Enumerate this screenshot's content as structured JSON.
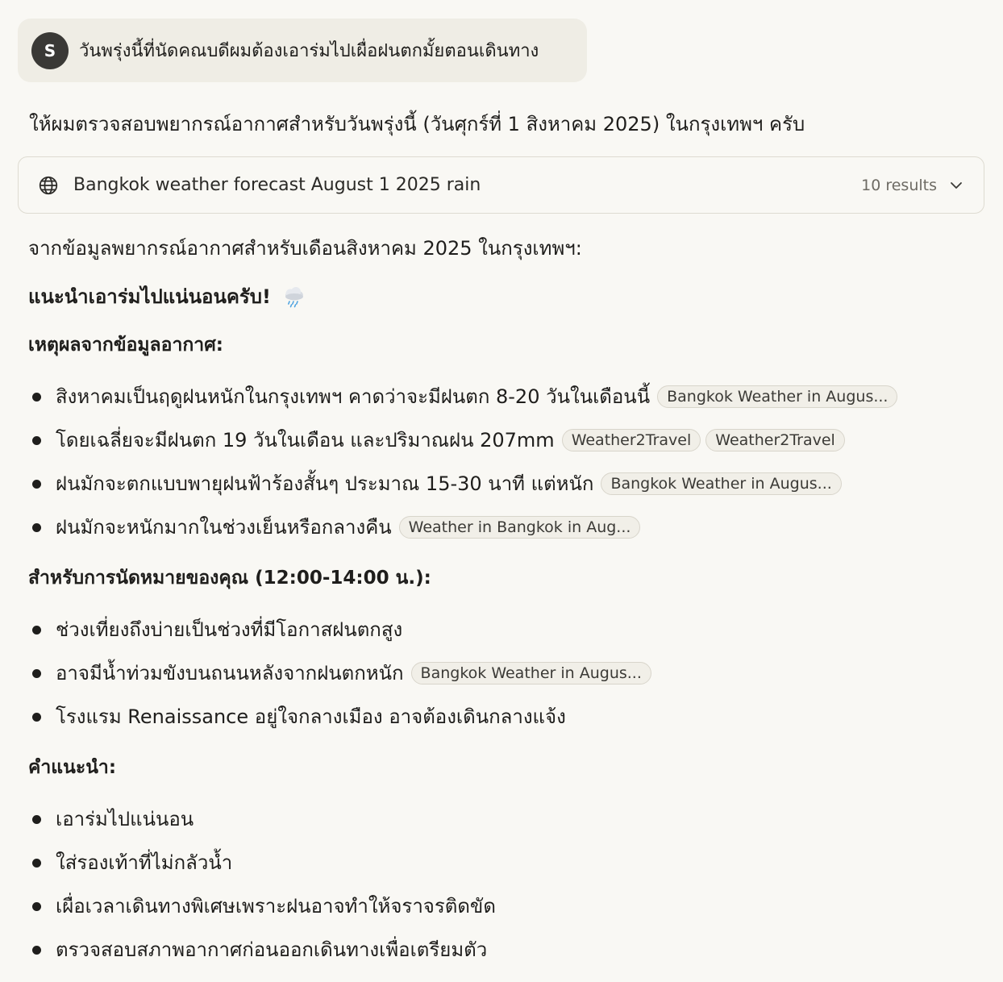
{
  "user_message": {
    "avatar_initial": "S",
    "text": "วันพรุ่งนี้ที่นัดคณบดีผมต้องเอาร่มไปเผื่อฝนตกมั้ยตอนเดินทาง"
  },
  "assistant": {
    "intro": "ให้ผมตรวจสอบพยากรณ์อากาศสำหรับวันพรุ่งนี้ (วันศุกร์ที่ 1 สิงหาคม 2025) ในกรุงเทพฯ ครับ",
    "search": {
      "query": "Bangkok weather forecast August 1 2025 rain",
      "results_count": "10 results"
    },
    "data_intro": "จากข้อมูลพยากรณ์อากาศสำหรับเดือนสิงหาคม 2025 ในกรุงเทพฯ:",
    "recommendation": "แนะนำเอาร่มไปแน่นอนครับ!",
    "reasons_heading": "เหตุผลจากข้อมูลอากาศ:",
    "reasons": [
      {
        "text": "สิงหาคมเป็นฤดูฝนหนักในกรุงเทพฯ คาดว่าจะมีฝนตก 8-20 วันในเดือนนี้",
        "chips": [
          "Bangkok Weather in Augus..."
        ]
      },
      {
        "text": "โดยเฉลี่ยจะมีฝนตก 19 วันในเดือน และปริมาณฝน 207mm",
        "chips": [
          "Weather2Travel",
          "Weather2Travel"
        ]
      },
      {
        "text": "ฝนมักจะตกแบบพายุฝนฟ้าร้องสั้นๆ ประมาณ 15-30 นาที แต่หนัก",
        "chips": [
          "Bangkok Weather in Augus..."
        ]
      },
      {
        "text": "ฝนมักจะหนักมากในช่วงเย็นหรือกลางคืน",
        "chips": [
          "Weather in Bangkok in Aug..."
        ]
      }
    ],
    "appointment_heading": "สำหรับการนัดหมายของคุณ (12:00-14:00 น.):",
    "appointment_points": [
      {
        "text": "ช่วงเที่ยงถึงบ่ายเป็นช่วงที่มีโอกาสฝนตกสูง",
        "chips": []
      },
      {
        "text": "อาจมีน้ำท่วมขังบนถนนหลังจากฝนตกหนัก",
        "chips": [
          "Bangkok Weather in Augus..."
        ]
      },
      {
        "text": "โรงแรม Renaissance อยู่ใจกลางเมือง อาจต้องเดินกลางแจ้ง",
        "chips": []
      }
    ],
    "advice_heading": "คำแนะนำ:",
    "advice": [
      "เอาร่มไปแน่นอน",
      "ใส่รองเท้าที่ไม่กลัวน้ำ",
      "เผื่อเวลาเดินทางพิเศษเพราะฝนอาจทำให้จราจรติดขัด",
      "ตรวจสอบสภาพอากาศก่อนออกเดินทางเพื่อเตรียมตัว"
    ]
  },
  "icons": {
    "globe": "globe-icon",
    "chevron": "chevron-down-icon",
    "rain": "cloud-rain-icon"
  }
}
